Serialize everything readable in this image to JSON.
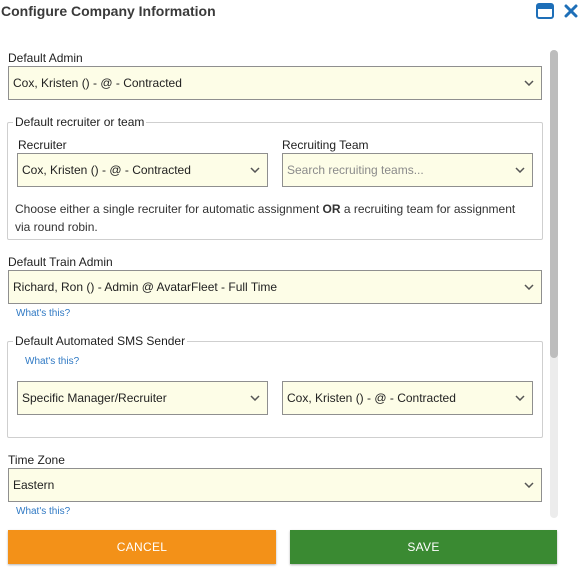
{
  "dialog": {
    "title": "Configure Company Information"
  },
  "default_admin": {
    "label": "Default Admin",
    "value": "Cox, Kristen () -  @  - Contracted"
  },
  "recruiter_group": {
    "legend": "Default recruiter or team",
    "recruiter_label": "Recruiter",
    "recruiter_value": "Cox, Kristen () -  @  - Contracted",
    "team_label": "Recruiting Team",
    "team_placeholder": "Search recruiting teams...",
    "help_before": "Choose either a single recruiter for automatic assignment ",
    "help_or": "OR",
    "help_after": " a recruiting team for assignment",
    "help_line2": "via round robin."
  },
  "train_admin": {
    "label": "Default Train Admin",
    "value": "Richard, Ron () - Admin @ AvatarFleet - Full Time",
    "whats_this": "What's this?"
  },
  "sms_group": {
    "legend": "Default Automated SMS Sender",
    "whats_this": "What's this?",
    "mode_value": "Specific Manager/Recruiter",
    "person_value": "Cox, Kristen () -  @  - Contracted"
  },
  "time_zone": {
    "label": "Time Zone",
    "value": "Eastern",
    "whats_this": "What's this?"
  },
  "buttons": {
    "cancel": "CANCEL",
    "save": "SAVE"
  },
  "colors": {
    "cancel": "#f39118",
    "save": "#3a8a32",
    "field_bg": "#fdfde7",
    "link": "#2f79c4"
  }
}
